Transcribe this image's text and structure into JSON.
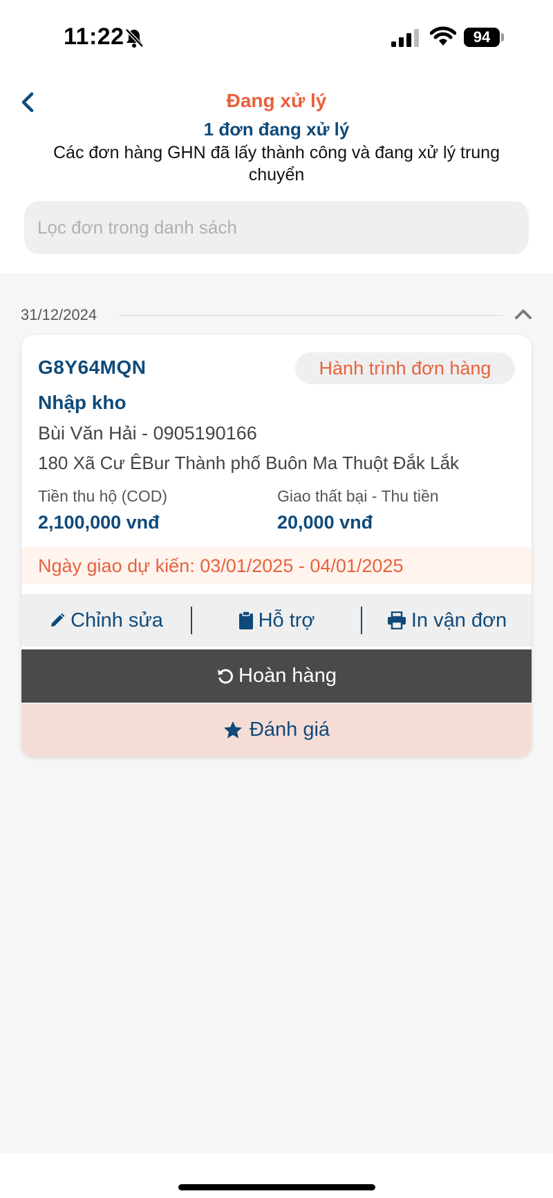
{
  "status_bar": {
    "time": "11:22",
    "battery": "94"
  },
  "header": {
    "title": "Đang xử lý",
    "subtitle": "1 đơn đang xử lý",
    "description": "Các đơn hàng GHN đã lấy thành công và đang xử lý trung chuyển"
  },
  "search": {
    "placeholder": "Lọc đơn trong danh sách",
    "value": ""
  },
  "date_group": {
    "date": "31/12/2024"
  },
  "order": {
    "code": "G8Y64MQN",
    "journey_label": "Hành trình đơn hàng",
    "status": "Nhập kho",
    "recipient": "Bùi Văn Hải - 0905190166",
    "address": "180  Xã Cư ÊBur Thành phố Buôn Ma Thuột Đắk Lắk",
    "cod_label": "Tiền thu hộ (COD)",
    "cod_value": "2,100,000 vnđ",
    "fail_label": "Giao thất bại - Thu tiền",
    "fail_value": "20,000 vnđ",
    "eta": "Ngày giao dự kiến: 03/01/2025 - 04/01/2025"
  },
  "actions": {
    "edit": "Chỉnh sửa",
    "support": "Hỗ trợ",
    "print": "In vận đơn",
    "return": "Hoàn hàng",
    "rate": "Đánh giá"
  },
  "colors": {
    "accent_orange": "#e8613c",
    "primary_blue": "#0f4a7a",
    "return_bg": "#4a4a4a",
    "rate_bg": "#f5ddd6"
  },
  "icons": [
    "bell-slash-icon",
    "signal-icon",
    "wifi-icon",
    "battery-icon",
    "chevron-left-icon",
    "chevron-up-icon",
    "pencil-icon",
    "clipboard-icon",
    "printer-icon",
    "undo-icon",
    "star-icon"
  ]
}
